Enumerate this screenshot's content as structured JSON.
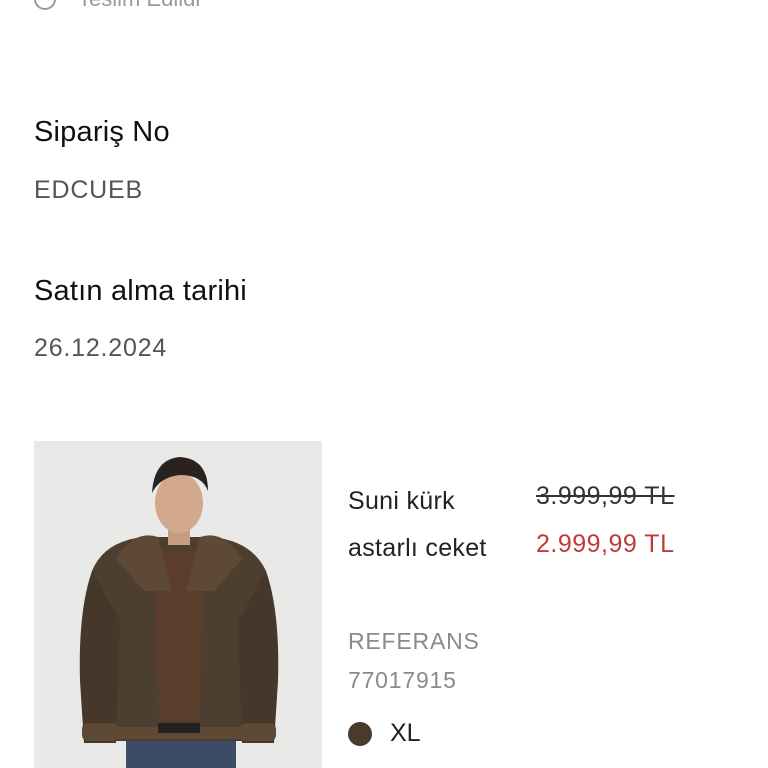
{
  "status": {
    "label": "Teslim Edildi"
  },
  "order": {
    "number_label": "Sipariş No",
    "number_value": "EDCUEB",
    "date_label": "Satın alma tarihi",
    "date_value": "26.12.2024"
  },
  "product": {
    "name": "Suni kürk astarlı ceket",
    "price_original": "3.999,99 TL",
    "price_sale": "2.999,99 TL",
    "reference_label": "REFERANS",
    "reference_value": "77017915",
    "color_hex": "#4a3a2c",
    "size": "XL",
    "colors": {
      "sale_price": "#c33a3a",
      "image_background": "#e9e9e7"
    }
  }
}
